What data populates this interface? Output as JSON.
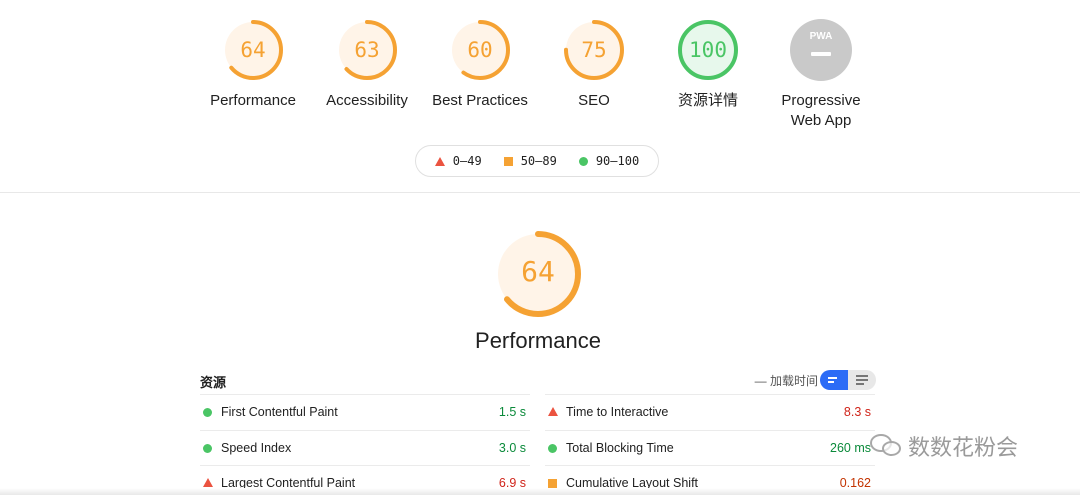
{
  "gauges": [
    {
      "label": "Performance",
      "score": "64",
      "score_value": 64,
      "status": "average"
    },
    {
      "label": "Accessibility",
      "score": "63",
      "score_value": 63,
      "status": "average"
    },
    {
      "label": "Best Practices",
      "score": "60",
      "score_value": 60,
      "status": "average"
    },
    {
      "label": "SEO",
      "score": "75",
      "score_value": 75,
      "status": "average"
    },
    {
      "label": "资源详情",
      "score": "100",
      "score_value": 100,
      "status": "pass"
    },
    {
      "label": "Progressive\nWeb App",
      "badge_text": "PWA",
      "status": "na"
    }
  ],
  "legend": [
    {
      "shape": "triangle",
      "text": "0–49"
    },
    {
      "shape": "square",
      "text": "50–89"
    },
    {
      "shape": "circle",
      "text": "90–100"
    }
  ],
  "main": {
    "score": "64",
    "score_value": 64,
    "title": "Performance"
  },
  "metrics": {
    "title": "资源",
    "toggle_label": "— 加载时间",
    "left": [
      {
        "name": "First Contentful Paint",
        "value": "1.5 s",
        "status": "good"
      },
      {
        "name": "Speed Index",
        "value": "3.0 s",
        "status": "good"
      },
      {
        "name": "Largest Contentful Paint",
        "value": "6.9 s",
        "status": "bad"
      }
    ],
    "right": [
      {
        "name": "Time to Interactive",
        "value": "8.3 s",
        "status": "bad"
      },
      {
        "name": "Total Blocking Time",
        "value": "260 ms",
        "status": "good"
      },
      {
        "name": "Cumulative Layout Shift",
        "value": "0.162",
        "status": "average"
      }
    ]
  },
  "watermark": {
    "text": "数数花粉会"
  },
  "colors": {
    "average": "#f5a233",
    "average_text": "#c33300",
    "average_bg": "#fff4e8",
    "pass": "#4ac565",
    "pass_text": "#0a8a3a",
    "pass_bg": "#e7f8ec",
    "fail": "#eb5340",
    "na": "#c9c9c9",
    "accent": "#2c6cf6"
  },
  "icons": {
    "fail": "triangle-icon",
    "average": "square-icon",
    "pass": "circle-icon",
    "toggle_active": "list-view-icon",
    "toggle_inactive": "detail-view-icon",
    "watermark": "wechat-icon"
  }
}
